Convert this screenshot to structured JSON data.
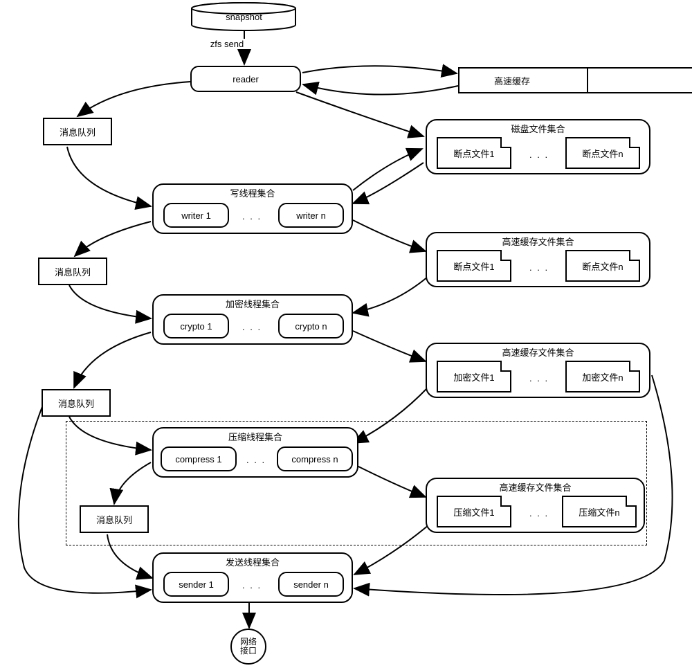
{
  "top": {
    "snapshot": "snapshot",
    "zfs_send": "zfs send",
    "reader": "reader",
    "cache": "高速缓存"
  },
  "queue": "消息队列",
  "disk_set": {
    "title": "磁盘文件集合",
    "file1": "断点文件1",
    "filen": "断点文件n",
    "dots": ". . ."
  },
  "writer_set": {
    "title": "写线程集合",
    "item1": "writer 1",
    "itemn": "writer n",
    "dots": ". . ."
  },
  "cache_set1": {
    "title": "高速缓存文件集合",
    "file1": "断点文件1",
    "filen": "断点文件n",
    "dots": ". . ."
  },
  "crypto_set": {
    "title": "加密线程集合",
    "item1": "crypto 1",
    "itemn": "crypto n",
    "dots": ". . ."
  },
  "cache_set2": {
    "title": "高速缓存文件集合",
    "file1": "加密文件1",
    "filen": "加密文件n",
    "dots": ". . ."
  },
  "compress_set": {
    "title": "压缩线程集合",
    "item1": "compress 1",
    "itemn": "compress n",
    "dots": ". . ."
  },
  "cache_set3": {
    "title": "高速缓存文件集合",
    "file1": "压缩文件1",
    "filen": "压缩文件n",
    "dots": ". . ."
  },
  "sender_set": {
    "title": "发送线程集合",
    "item1": "sender 1",
    "itemn": "sender n",
    "dots": ". . ."
  },
  "network": "网络\n接口"
}
